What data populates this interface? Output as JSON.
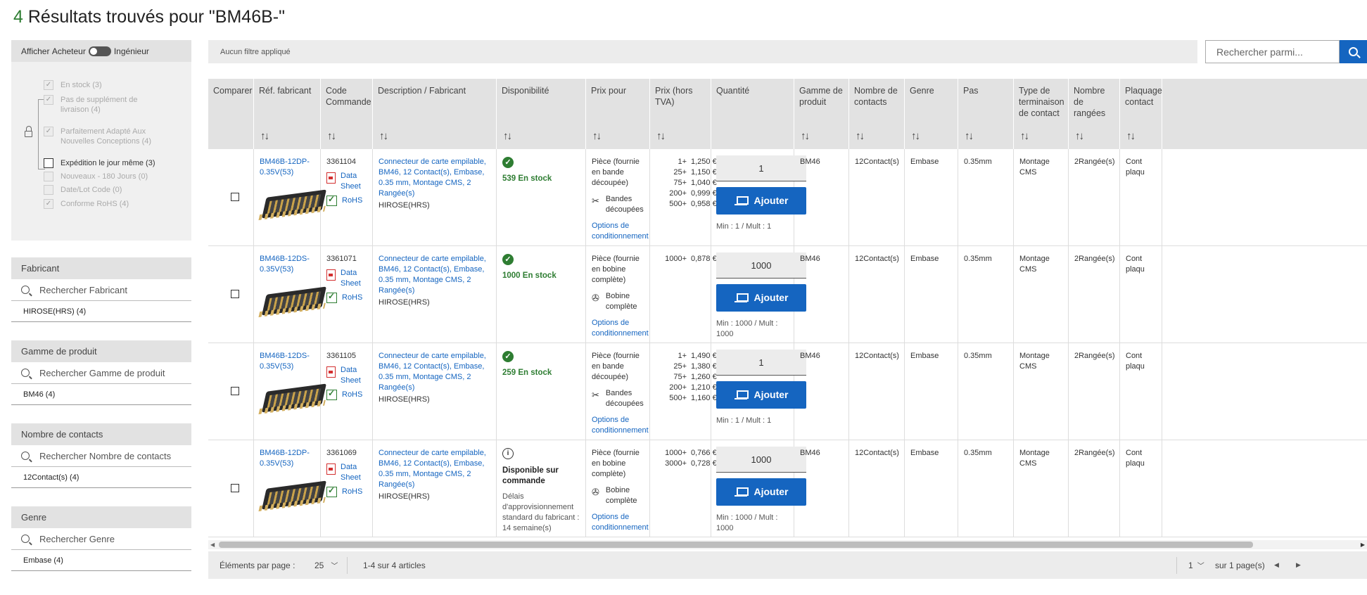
{
  "title": {
    "count": "4",
    "text": "Résultats trouvés pour \"BM46B-\""
  },
  "sidebar": {
    "toggle": {
      "prefix": "Afficher",
      "left": "Acheteur",
      "right": "Ingénieur"
    },
    "checks": [
      {
        "label": "En stock (3)",
        "checked": true,
        "disabled": true
      },
      {
        "label": "Pas de supplément de livraison (4)",
        "checked": true,
        "disabled": true
      },
      {
        "label": "Parfaitement Adapté Aux Nouvelles Conceptions (4)",
        "checked": true,
        "disabled": true
      },
      {
        "label": "Expédition le jour même (3)",
        "checked": false,
        "disabled": false
      },
      {
        "label": "Nouveaux - 180 Jours (0)",
        "checked": false,
        "disabled": true
      },
      {
        "label": "Date/Lot Code (0)",
        "checked": false,
        "disabled": true
      },
      {
        "label": "Conforme RoHS (4)",
        "checked": true,
        "disabled": true
      }
    ],
    "facets": [
      {
        "title": "Fabricant",
        "placeholder": "Rechercher Fabricant",
        "value": "HIROSE(HRS) (4)"
      },
      {
        "title": "Gamme de produit",
        "placeholder": "Rechercher Gamme de produit",
        "value": "BM46 (4)"
      },
      {
        "title": "Nombre de contacts",
        "placeholder": "Rechercher Nombre de contacts",
        "value": "12Contact(s) (4)"
      },
      {
        "title": "Genre",
        "placeholder": "Rechercher Genre",
        "value": "Embase (4)"
      }
    ]
  },
  "filterbar": {
    "text": "Aucun filtre appliqué"
  },
  "search": {
    "placeholder": "Rechercher parmi..."
  },
  "columns": [
    "Comparer",
    "Réf. fabricant",
    "Code Commande",
    "Description / Fabricant",
    "Disponibilité",
    "Prix pour",
    "Prix (hors TVA)",
    "Quantité",
    "Gamme de produit",
    "Nombre de contacts",
    "Genre",
    "Pas",
    "Type de terminaison de contact",
    "Nombre de rangées",
    "Plaquage contact"
  ],
  "rows": [
    {
      "ref": "BM46B-12DP-0.35V(53)",
      "code": "3361104",
      "desc": "Connecteur de carte empilable, BM46, 12 Contact(s), Embase, 0.35 mm, Montage CMS, 2 Rangée(s)",
      "maker": "HIROSE(HRS)",
      "avail": "539 En stock",
      "avail_status": "ok",
      "avail_extra": "",
      "price_for": "Pièce (fournie en bande découpée)",
      "pack": "Bandes découpées",
      "pack_icon": "scissors-icon",
      "prices": [
        [
          "1+",
          "1,250 €"
        ],
        [
          "25+",
          "1,150 €"
        ],
        [
          "75+",
          "1,040 €"
        ],
        [
          "200+",
          "0,999 €"
        ],
        [
          "500+",
          "0,958 €"
        ]
      ],
      "qty": "1",
      "minmult": "Min : 1 / Mult : 1",
      "range": "BM46",
      "contacts": "12Contact(s)",
      "genre": "Embase",
      "pas": "0.35mm",
      "term": "Montage CMS",
      "rangees": "2Rangée(s)",
      "plaq": "Cont plaqu"
    },
    {
      "ref": "BM46B-12DS-0.35V(53)",
      "code": "3361071",
      "desc": "Connecteur de carte empilable, BM46, 12 Contact(s), Embase, 0.35 mm, Montage CMS, 2 Rangée(s)",
      "maker": "HIROSE(HRS)",
      "avail": "1000 En stock",
      "avail_status": "ok",
      "avail_extra": "",
      "price_for": "Pièce (fournie en bobine complète)",
      "pack": "Bobine complète",
      "pack_icon": "reel-icon",
      "prices": [
        [
          "1000+",
          "0,878 €"
        ]
      ],
      "qty": "1000",
      "minmult": "Min : 1000 / Mult : 1000",
      "range": "BM46",
      "contacts": "12Contact(s)",
      "genre": "Embase",
      "pas": "0.35mm",
      "term": "Montage CMS",
      "rangees": "2Rangée(s)",
      "plaq": "Cont plaqu"
    },
    {
      "ref": "BM46B-12DS-0.35V(53)",
      "code": "3361105",
      "desc": "Connecteur de carte empilable, BM46, 12 Contact(s), Embase, 0.35 mm, Montage CMS, 2 Rangée(s)",
      "maker": "HIROSE(HRS)",
      "avail": "259 En stock",
      "avail_status": "ok",
      "avail_extra": "",
      "price_for": "Pièce (fournie en bande découpée)",
      "pack": "Bandes découpées",
      "pack_icon": "scissors-icon",
      "prices": [
        [
          "1+",
          "1,490 €"
        ],
        [
          "25+",
          "1,380 €"
        ],
        [
          "75+",
          "1,260 €"
        ],
        [
          "200+",
          "1,210 €"
        ],
        [
          "500+",
          "1,160 €"
        ]
      ],
      "qty": "1",
      "minmult": "Min : 1 / Mult : 1",
      "range": "BM46",
      "contacts": "12Contact(s)",
      "genre": "Embase",
      "pas": "0.35mm",
      "term": "Montage CMS",
      "rangees": "2Rangée(s)",
      "plaq": "Cont plaqu"
    },
    {
      "ref": "BM46B-12DP-0.35V(53)",
      "code": "3361069",
      "desc": "Connecteur de carte empilable, BM46, 12 Contact(s), Embase, 0.35 mm, Montage CMS, 2 Rangée(s)",
      "maker": "HIROSE(HRS)",
      "avail": "Disponible sur commande",
      "avail_status": "info",
      "avail_extra": "Délais d'approvisionnement standard du fabricant : 14 semaine(s)",
      "price_for": "Pièce (fournie en bobine complète)",
      "pack": "Bobine complète",
      "pack_icon": "reel-icon",
      "prices": [
        [
          "1000+",
          "0,766 €"
        ],
        [
          "3000+",
          "0,728 €"
        ]
      ],
      "qty": "1000",
      "minmult": "Min : 1000 / Mult : 1000",
      "range": "BM46",
      "contacts": "12Contact(s)",
      "genre": "Embase",
      "pas": "0.35mm",
      "term": "Montage CMS",
      "rangees": "2Rangée(s)",
      "plaq": "Cont plaqu"
    }
  ],
  "labels": {
    "datasheet": "Data Sheet",
    "rohs": "RoHS",
    "add": "Ajouter",
    "options": "Options de conditionnement"
  },
  "pager": {
    "per_page_label": "Éléments par page :",
    "per_page": "25",
    "range": "1-4 sur 4 articles",
    "page": "1",
    "of_pages": "sur 1 page(s)"
  },
  "colors": {
    "accent": "#1565c0",
    "stock": "#2e7d32",
    "header_bg": "#e2e2e2"
  }
}
